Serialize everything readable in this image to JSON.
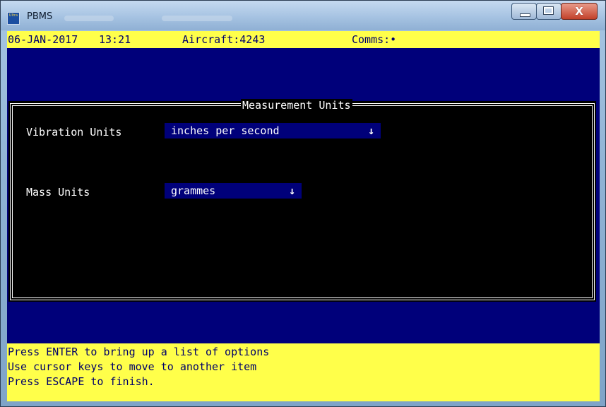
{
  "window": {
    "title": "PBMS",
    "icon_text": "Ultra",
    "controls": {
      "minimize": "_",
      "maximize": "□",
      "close": "X"
    }
  },
  "status": {
    "date": "06-JAN-2017",
    "time": "13:21",
    "aircraft": "Aircraft:4243",
    "comms": "Comms:•"
  },
  "dialog": {
    "title": "Measurement Units",
    "vibration": {
      "label": "Vibration Units",
      "value": "inches per second",
      "arrow": "↓"
    },
    "mass": {
      "label": "Mass Units",
      "value": "grammes",
      "arrow": "↓"
    }
  },
  "help": {
    "line1": "Press ENTER to bring up a list of options",
    "line2": "Use cursor keys to move to another item",
    "line3": "Press ESCAPE to finish."
  },
  "colors": {
    "background": "#00007a",
    "bars": "#ffff4a",
    "bar_text": "#00006a",
    "dialog": "#000000",
    "dialog_text": "#ffffff"
  }
}
